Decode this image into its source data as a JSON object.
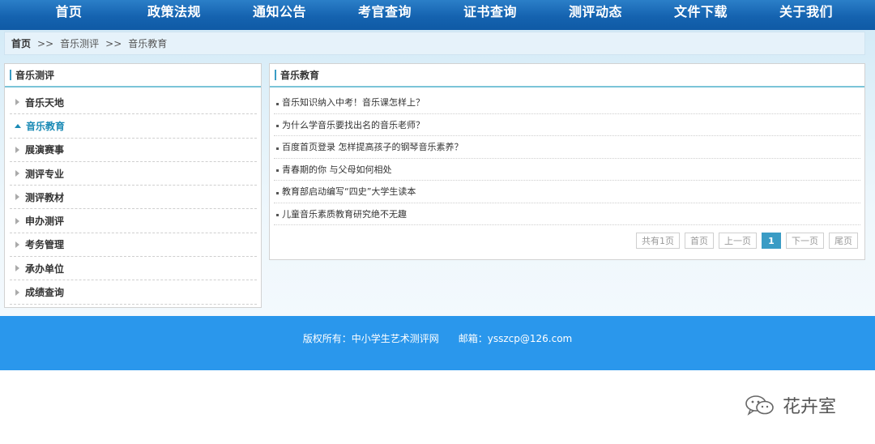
{
  "nav": {
    "items": [
      "首页",
      "政策法规",
      "通知公告",
      "考官查询",
      "证书查询",
      "测评动态",
      "文件下载",
      "关于我们"
    ]
  },
  "breadcrumb": {
    "home": "首页",
    "separator": ">>",
    "level1": "音乐测评",
    "level2": "音乐教育"
  },
  "sidebar": {
    "title": "音乐测评",
    "items": [
      {
        "label": "音乐天地",
        "active": false
      },
      {
        "label": "音乐教育",
        "active": true
      },
      {
        "label": "展演赛事",
        "active": false
      },
      {
        "label": "测评专业",
        "active": false
      },
      {
        "label": "测评教材",
        "active": false
      },
      {
        "label": "申办测评",
        "active": false
      },
      {
        "label": "考务管理",
        "active": false
      },
      {
        "label": "承办单位",
        "active": false
      },
      {
        "label": "成绩查询",
        "active": false
      }
    ]
  },
  "main": {
    "title": "音乐教育",
    "articles": [
      "音乐知识纳入中考！音乐课怎样上？",
      "为什么学音乐要找出名的音乐老师？",
      "百度首页登录 怎样提高孩子的钢琴音乐素养？",
      "青春期的你 与父母如何相处",
      "教育部启动编写“四史”大学生读本",
      "儿童音乐素质教育研究绝不无趣"
    ],
    "pager": {
      "total": "共有1页",
      "first": "首页",
      "prev": "上一页",
      "current": "1",
      "next": "下一页",
      "last": "尾页"
    }
  },
  "footer": {
    "copyright": "版权所有：中小学生艺术测评网",
    "email": "邮箱：ysszcp@126.com"
  },
  "watermark": {
    "text": "花卉室"
  },
  "colors": {
    "nav_bg": "#1563b0",
    "accent": "#3a9cc5",
    "active_link": "#1a8ab5",
    "footer_bg": "#2a97ec"
  }
}
